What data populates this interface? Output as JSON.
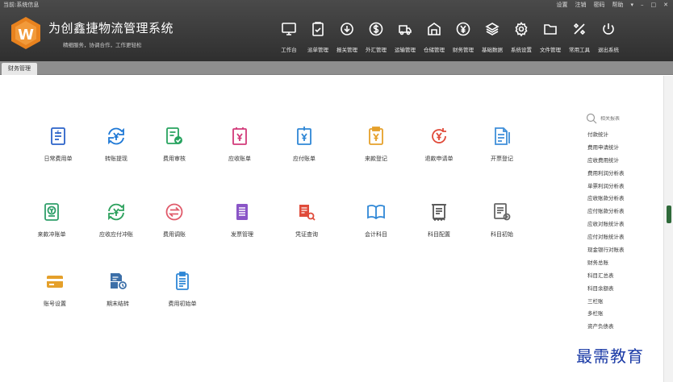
{
  "header": {
    "info_text": "当前:系统信息",
    "title": "为创鑫捷物流管理系统",
    "slogan": "精细服务，协调合作，工作更轻松",
    "window_controls": [
      "设置",
      "注销",
      "密码",
      "帮助",
      "▾",
      "–",
      "□",
      "✕"
    ]
  },
  "nav": [
    {
      "label": "工作台",
      "icon": "monitor-icon"
    },
    {
      "label": "派单管理",
      "icon": "clipboard-check-icon"
    },
    {
      "label": "报关管理",
      "icon": "down-arrow-circle-icon"
    },
    {
      "label": "外汇管理",
      "icon": "dollar-circle-icon"
    },
    {
      "label": "运输管理",
      "icon": "truck-icon"
    },
    {
      "label": "仓储管理",
      "icon": "warehouse-icon"
    },
    {
      "label": "财务管理",
      "icon": "yen-circle-icon"
    },
    {
      "label": "基础数据",
      "icon": "layers-icon"
    },
    {
      "label": "系统设置",
      "icon": "gear-icon"
    },
    {
      "label": "文件管理",
      "icon": "folder-icon"
    },
    {
      "label": "常用工具",
      "icon": "tools-icon"
    },
    {
      "label": "退出系统",
      "icon": "power-icon"
    }
  ],
  "tabs": [
    {
      "label": "财务管理"
    }
  ],
  "tiles": [
    {
      "label": "日常费用单",
      "icon": "receipt-icon",
      "color": "#2b63c9"
    },
    {
      "label": "转账提现",
      "icon": "yen-exchange-icon",
      "color": "#1e78d6"
    },
    {
      "label": "费用审核",
      "icon": "audit-check-icon",
      "color": "#27a35f"
    },
    {
      "label": "应收账单",
      "icon": "yen-bill-icon",
      "color": "#d23a7a"
    },
    {
      "label": "应付账单",
      "icon": "yen-bill-out-icon",
      "color": "#2f87d6"
    },
    {
      "label": "来款登记",
      "icon": "yen-clipboard-icon",
      "color": "#e5a02a"
    },
    {
      "label": "退款申请单",
      "icon": "yen-refund-icon",
      "color": "#e04b3a"
    },
    {
      "label": "开票登记",
      "icon": "invoice-doc-icon",
      "color": "#3f8fd9"
    },
    {
      "label": "来款冲账单",
      "icon": "yen-ledger-icon",
      "color": "#2f9f6a"
    },
    {
      "label": "应收应付冲账",
      "icon": "yen-cycle-icon",
      "color": "#2da15d"
    },
    {
      "label": "费用调账",
      "icon": "swap-circle-icon",
      "color": "#e05a6a"
    },
    {
      "label": "发票管理",
      "icon": "invoice-list-icon",
      "color": "#8a55c7"
    },
    {
      "label": "凭证查询",
      "icon": "voucher-search-icon",
      "color": "#e04b3a"
    },
    {
      "label": "会计科目",
      "icon": "book-icon",
      "color": "#2f87d6"
    },
    {
      "label": "科目配置",
      "icon": "scroll-icon",
      "color": "#555555"
    },
    {
      "label": "科目初始",
      "icon": "subject-init-icon",
      "color": "#666666"
    },
    {
      "label": "账号设置",
      "icon": "card-icon",
      "color": "#e5a02a"
    },
    {
      "label": "期末结转",
      "icon": "period-close-icon",
      "color": "#3c6fa8"
    },
    {
      "label": "费用初始单",
      "icon": "form-list-icon",
      "color": "#2f87d6"
    }
  ],
  "report_panel": {
    "search_placeholder": "相关报表",
    "items": [
      "付款统计",
      "费用申请统计",
      "应收费用统计",
      "费用利润分析表",
      "单票利润分析表",
      "应收账款分析表",
      "应付账款分析表",
      "应收对账统计表",
      "应付对账统计表",
      "现金银行对账表",
      "财务总账",
      "科目汇总表",
      "科目余额表",
      "三栏账",
      "多栏账",
      "资产负债表"
    ]
  },
  "watermark": "最需教育"
}
